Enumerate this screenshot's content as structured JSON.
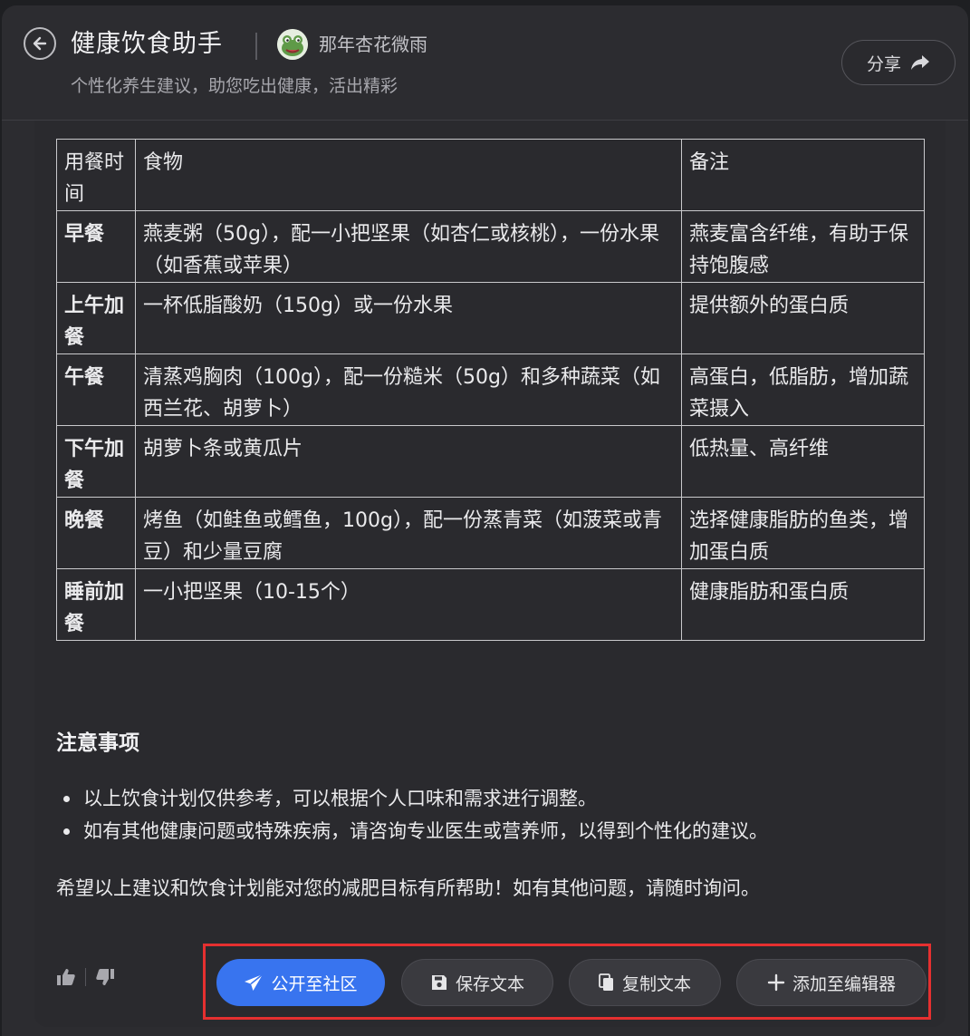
{
  "header": {
    "title": "健康饮食助手",
    "author": "那年杏花微雨",
    "subtitle": "个性化养生建议，助您吃出健康，活出精彩",
    "share_label": "分享"
  },
  "table": {
    "headers": [
      "用餐时间",
      "食物",
      "备注"
    ],
    "rows": [
      {
        "time": "早餐",
        "food": "燕麦粥（50g），配一小把坚果（如杏仁或核桃），一份水果（如香蕉或苹果）",
        "note": "燕麦富含纤维，有助于保持饱腹感"
      },
      {
        "time": "上午加餐",
        "food": "一杯低脂酸奶（150g）或一份水果",
        "note": "提供额外的蛋白质"
      },
      {
        "time": "午餐",
        "food": "清蒸鸡胸肉（100g），配一份糙米（50g）和多种蔬菜（如西兰花、胡萝卜）",
        "note": "高蛋白，低脂肪，增加蔬菜摄入"
      },
      {
        "time": "下午加餐",
        "food": "胡萝卜条或黄瓜片",
        "note": "低热量、高纤维"
      },
      {
        "time": "晚餐",
        "food": "烤鱼（如鲑鱼或鳕鱼，100g），配一份蒸青菜（如菠菜或青豆）和少量豆腐",
        "note": "选择健康脂肪的鱼类，增加蛋白质"
      },
      {
        "time": "睡前加餐",
        "food": "一小把坚果（10-15个）",
        "note": "健康脂肪和蛋白质"
      }
    ]
  },
  "notes": {
    "title": "注意事项",
    "items": [
      "以上饮食计划仅供参考，可以根据个人口味和需求进行调整。",
      "如有其他健康问题或特殊疾病，请咨询专业医生或营养师，以得到个性化的建议。"
    ]
  },
  "closing": "希望以上建议和饮食计划能对您的减肥目标有所帮助！如有其他问题，请随时询问。",
  "actions": {
    "publish": "公开至社区",
    "save": "保存文本",
    "copy": "复制文本",
    "add_editor": "添加至编辑器"
  },
  "colors": {
    "primary": "#3874ef",
    "highlight": "#e53030",
    "background": "#2a2a2e"
  }
}
